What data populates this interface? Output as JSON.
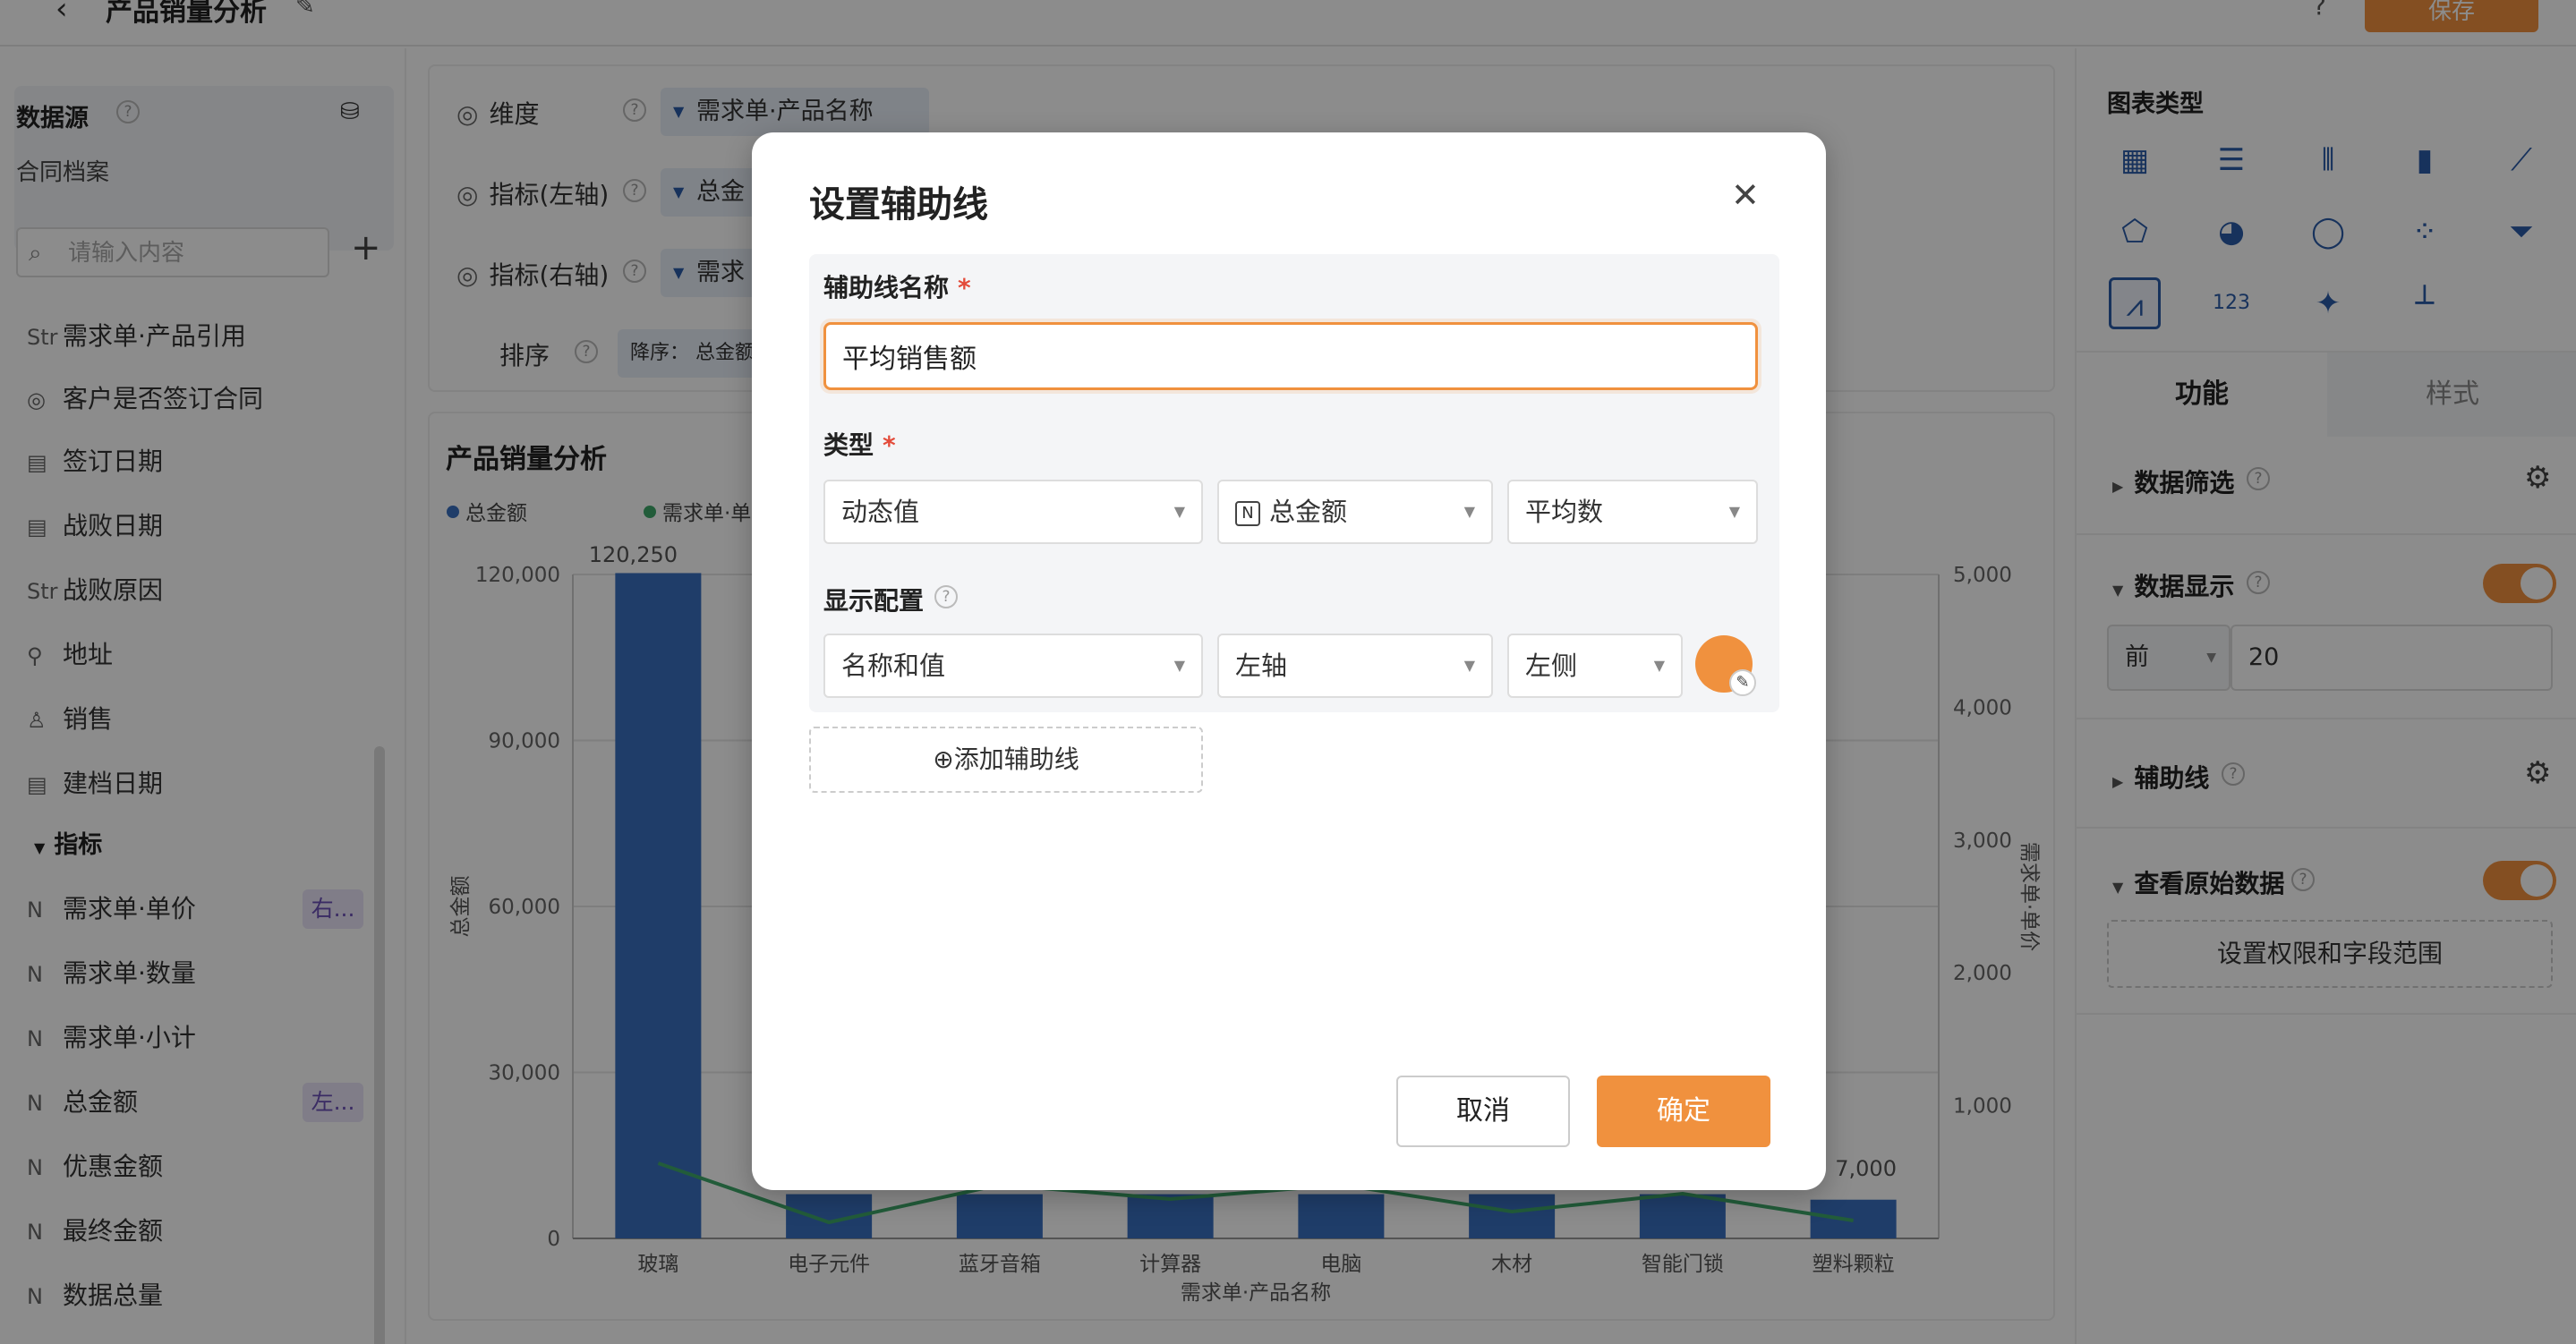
{
  "header": {
    "back_icon": "chevron-left-icon",
    "title": "产品销量分析",
    "save_label": "保存",
    "help_label": "?"
  },
  "sidebar": {
    "datasource_title": "数据源",
    "datasource_name": "合同档案",
    "search_placeholder": "请输入内容",
    "add_label": "+",
    "fields": [
      {
        "prefix": "Str",
        "label": "需求单·产品引用"
      },
      {
        "prefix": "◎",
        "label": "客户是否签订合同"
      },
      {
        "prefix": "▤",
        "label": "签订日期"
      },
      {
        "prefix": "▤",
        "label": "战败日期"
      },
      {
        "prefix": "Str",
        "label": "战败原因"
      },
      {
        "prefix": "⚲",
        "label": "地址"
      },
      {
        "prefix": "♙",
        "label": "销售"
      },
      {
        "prefix": "▤",
        "label": "建档日期"
      }
    ],
    "metrics_group": "指标",
    "metrics": [
      {
        "prefix": "N",
        "label": "需求单·单价",
        "tag": "右..."
      },
      {
        "prefix": "N",
        "label": "需求单·数量",
        "tag": ""
      },
      {
        "prefix": "N",
        "label": "需求单·小计",
        "tag": ""
      },
      {
        "prefix": "N",
        "label": "总金额",
        "tag": "左..."
      },
      {
        "prefix": "N",
        "label": "优惠金额",
        "tag": ""
      },
      {
        "prefix": "N",
        "label": "最终金额",
        "tag": ""
      },
      {
        "prefix": "N",
        "label": "数据总量",
        "tag": ""
      }
    ]
  },
  "config": {
    "dimension_label": "维度",
    "dimension_value": "需求单·产品名称",
    "left_metric_label": "指标(左轴)",
    "left_metric_value": "总金",
    "right_metric_label": "指标(右轴)",
    "right_metric_value": "需求",
    "sort_label": "排序",
    "sort_value": "降序： 总金额"
  },
  "chart_data": {
    "type": "bar",
    "title": "产品销量分析",
    "legend": [
      "总金额",
      "需求单·单"
    ],
    "categories": [
      "玻璃",
      "电子元件",
      "蓝牙音箱",
      "计算器",
      "电脑",
      "木材",
      "智能门锁",
      "塑料颗粒"
    ],
    "ylabel": "总金额",
    "y2label": "需求单·单价",
    "xlabel": "需求单·产品名称",
    "ylim": [
      0,
      120000
    ],
    "y2lim": [
      0,
      5000
    ],
    "yticks": [
      "120,000",
      "90,000",
      "60,000",
      "30,000",
      "0"
    ],
    "y2ticks": [
      "5,000",
      "4,000",
      "3,000",
      "2,000",
      "1,000"
    ],
    "top_label": "120,250",
    "last_label": "7,000",
    "series": [
      {
        "values": [
          120250,
          8000,
          8000,
          8000,
          8000,
          8000,
          8000,
          7000
        ]
      }
    ],
    "colors": {
      "bar": "#3a6fc0",
      "line": "#3fa86a"
    }
  },
  "right_panel": {
    "chart_type_title": "图表类型",
    "chart_types": [
      "table-icon",
      "list-icon",
      "bar-horizontal-icon",
      "bar-icon",
      "line-icon",
      "radar-icon",
      "pie-icon",
      "donut-icon",
      "scatter-icon",
      "funnel-icon",
      "combo-chart-icon",
      "kpi-icon",
      "map-icon",
      "tree-icon"
    ],
    "tab_function": "功能",
    "tab_style": "样式",
    "filter_label": "数据筛选",
    "display_label": "数据显示",
    "display_mode": "前",
    "display_count": "20",
    "auxline_label": "辅助线",
    "raw_data_label": "查看原始数据",
    "permission_button": "设置权限和字段范围"
  },
  "modal": {
    "title": "设置辅助线",
    "name_label": "辅助线名称",
    "name_value": "平均销售额",
    "type_label": "类型",
    "type_value": "动态值",
    "field_value": "总金额",
    "agg_value": "平均数",
    "display_label": "显示配置",
    "display_value": "名称和值",
    "axis_value": "左轴",
    "side_value": "左侧",
    "color": "#f0913e",
    "add_label": "添加辅助线",
    "cancel_label": "取消",
    "ok_label": "确定"
  }
}
